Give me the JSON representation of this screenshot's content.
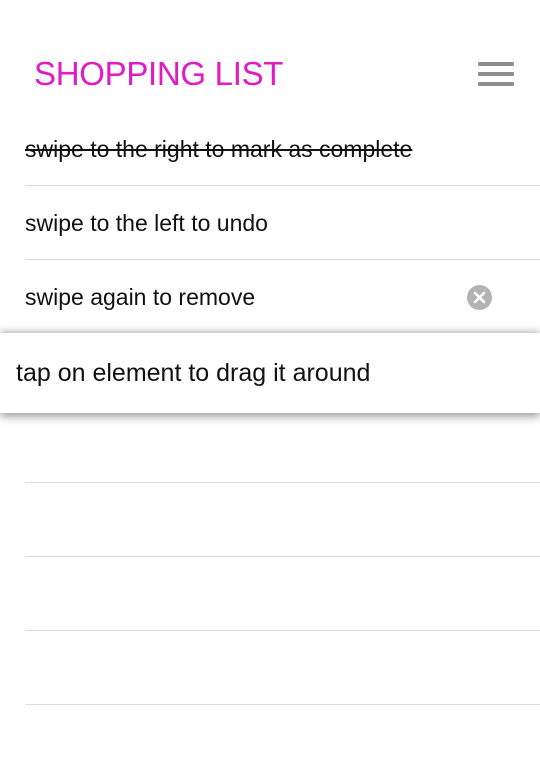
{
  "header": {
    "title": "SHOPPING LIST",
    "title_color": "#e01bc4",
    "menu_icon": "hamburger-menu-icon"
  },
  "items": [
    {
      "text": "swipe to the right to mark as complete",
      "completed": true
    },
    {
      "text": "swipe to the left to undo",
      "completed": false
    },
    {
      "text": "swipe again to remove",
      "completed": false,
      "remove_icon": "clear-circle-icon"
    }
  ],
  "dragging_item": {
    "text": "tap on element to drag it around"
  },
  "colors": {
    "accent": "#e01bc4",
    "divider": "#dcdcdc",
    "icon_gray": "#8c8c8c"
  }
}
